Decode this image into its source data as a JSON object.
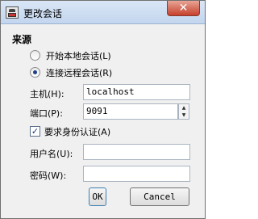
{
  "window": {
    "title": "更改会话",
    "close_symbol": "✕"
  },
  "group": {
    "title": "来源",
    "radio_local": {
      "label": "开始本地会话(L)",
      "checked": false
    },
    "radio_remote": {
      "label": "连接远程会话(R)",
      "checked": true
    }
  },
  "host": {
    "label": "主机(H):",
    "value": "localhost"
  },
  "port": {
    "label": "端口(P):",
    "value": "9091"
  },
  "auth": {
    "label": "要求身份认证(A)",
    "checked": true
  },
  "username": {
    "label": "用户名(U):",
    "value": ""
  },
  "password": {
    "label": "密码(W):",
    "value": ""
  },
  "buttons": {
    "ok": "OK",
    "cancel": "Cancel"
  }
}
